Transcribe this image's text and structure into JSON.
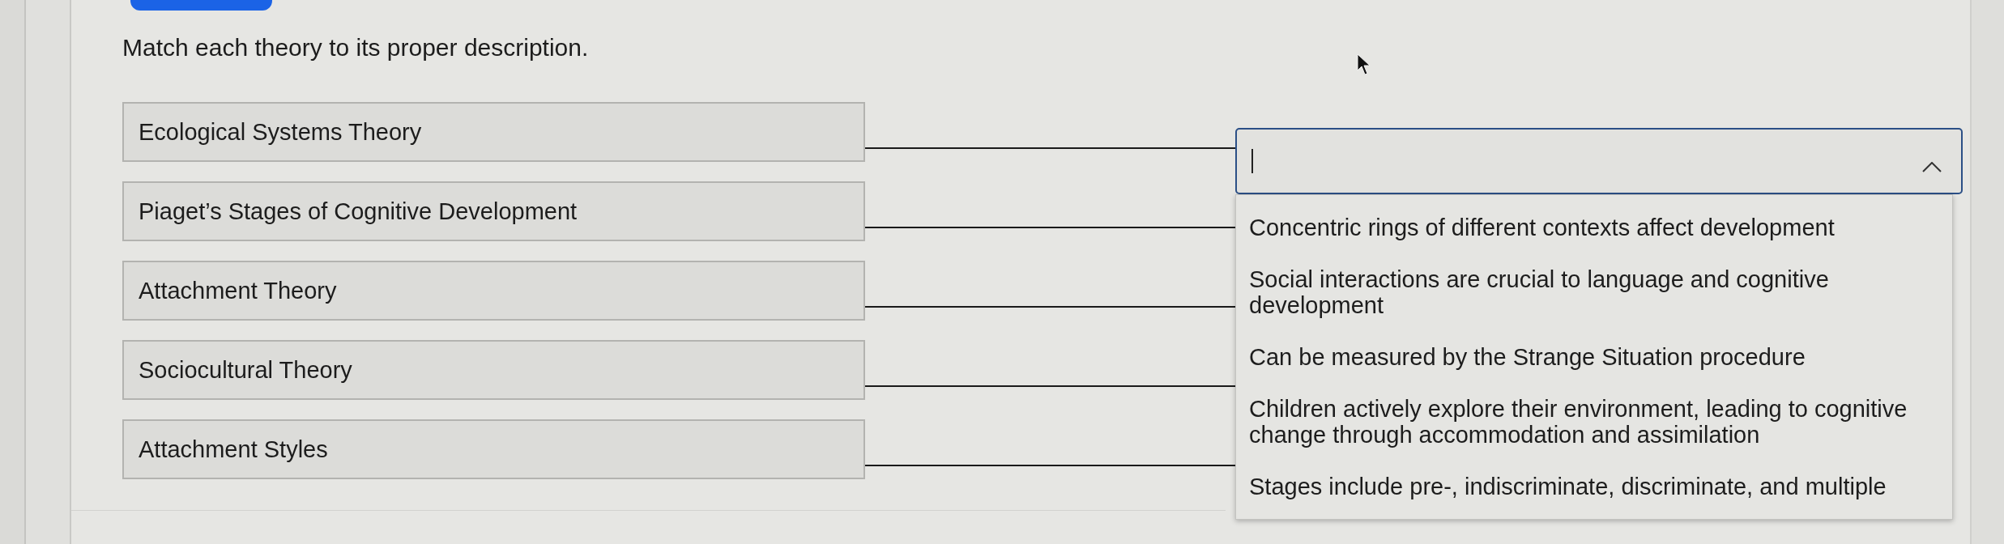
{
  "prompt": "Match each theory to its proper description.",
  "terms": [
    "Ecological Systems Theory",
    "Piaget’s Stages of Cognitive Development",
    "Attachment Theory",
    "Sociocultural Theory",
    "Attachment Styles"
  ],
  "dropdown": {
    "focused": true,
    "expanded": true,
    "options": [
      "Concentric rings of different contexts affect development",
      "Social interactions are crucial to language and cognitive development",
      "Can be measured by the Strange Situation procedure",
      "Children actively explore their environment, leading to cognitive change through accommodation and assimilation",
      "Stages include pre-, indiscriminate, discriminate, and multiple"
    ]
  }
}
